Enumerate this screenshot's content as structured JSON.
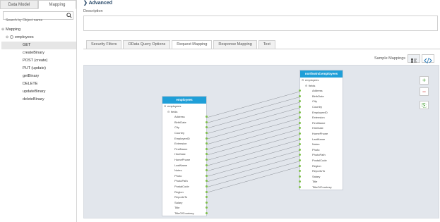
{
  "left_panel": {
    "tabs": [
      {
        "label": "Data Model"
      },
      {
        "label": "Mapping"
      }
    ],
    "search_placeholder": "Search by Object name",
    "tree": {
      "root": "Mapping",
      "object": "employees",
      "operations": [
        {
          "label": "GET",
          "selected": true
        },
        {
          "label": "createBinary"
        },
        {
          "label": "POST (create)"
        },
        {
          "label": "PUT (update)"
        },
        {
          "label": "getBinary"
        },
        {
          "label": "DELETE"
        },
        {
          "label": "updateBinary"
        },
        {
          "label": "deleteBinary"
        }
      ]
    }
  },
  "main": {
    "advanced_label": "Advanced",
    "description_label": "Description",
    "tabs": [
      {
        "label": "Security Filters"
      },
      {
        "label": "OData Query Options"
      },
      {
        "label": "Request Mapping",
        "active": true
      },
      {
        "label": "Response Mapping"
      },
      {
        "label": "Test"
      }
    ],
    "sample_mappings_label": "Sample Mappings",
    "side_buttons": [
      "+",
      "−",
      "⎘"
    ]
  },
  "source_node": {
    "title": "employees",
    "root": "employees",
    "group": "fields",
    "fields": [
      "Address",
      "BirthDate",
      "City",
      "Country",
      "EmployeeID",
      "Extension",
      "FirstName",
      "HireDate",
      "HomePhone",
      "LastName",
      "Notes",
      "Photo",
      "PhotoPath",
      "PostalCode",
      "Region",
      "ReportsTo",
      "Salary",
      "Title",
      "TitleOfCourtesy"
    ]
  },
  "target_node": {
    "title": "northwind.employees",
    "root": "employees",
    "group": "fields",
    "fields": [
      "Address",
      "BirthDate",
      "City",
      "Country",
      "EmployeeID",
      "Extension",
      "FirstName",
      "HireDate",
      "HomePhone",
      "LastName",
      "Notes",
      "Photo",
      "PhotoPath",
      "PostalCode",
      "Region",
      "ReportsTo",
      "Salary",
      "Title",
      "TitleOfCourtesy"
    ]
  },
  "connections_count_visible": 15,
  "colors": {
    "node_header": "#1f9fd8",
    "connector": "#7fc04a",
    "canvas": "#e2e6ec"
  }
}
